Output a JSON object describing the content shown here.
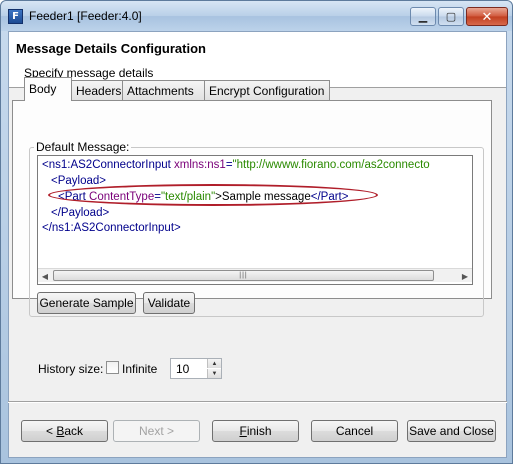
{
  "window": {
    "title": "Feeder1 [Feeder:4.0]",
    "app_icon_letter": "F",
    "controls": {
      "minimize": "▁",
      "maximize": "▢",
      "close": "✕"
    }
  },
  "header": {
    "title": "Message Details Configuration",
    "subtitle": "Specify message details"
  },
  "tabs": [
    {
      "label": "Body",
      "active": true
    },
    {
      "label": "Headers",
      "active": false
    },
    {
      "label": "Attachments",
      "active": false
    },
    {
      "label": "Encrypt Configuration",
      "active": false
    }
  ],
  "body_tab": {
    "group_label": "Default Message:",
    "editor_lines": [
      {
        "open": "<ns1:AS2ConnectorInput ",
        "attr": "xmlns:ns1",
        "eq": "=",
        "value": "\"http://wwww.fiorano.com/as2connecto",
        "text": "",
        "close": ""
      },
      {
        "open": "<Payload>",
        "attr": "",
        "eq": "",
        "value": "",
        "text": "",
        "close": ""
      },
      {
        "open": "<Part ",
        "attr": "ContentType",
        "eq": "=",
        "value": "\"text/plain\"",
        "text": ">Sample message",
        "close": "</Part>"
      },
      {
        "open": "</Payload>",
        "attr": "",
        "eq": "",
        "value": "",
        "text": "",
        "close": ""
      },
      {
        "open": "</ns1:AS2ConnectorInput>",
        "attr": "",
        "eq": "",
        "value": "",
        "text": "",
        "close": ""
      }
    ],
    "scroll_thumb_grip": "|||",
    "buttons": {
      "generate_sample": "Generate Sample",
      "validate": "Validate"
    }
  },
  "history": {
    "label": "History size:",
    "infinite_label": "Infinite",
    "infinite_checked": false,
    "value": "10"
  },
  "footer": {
    "back": {
      "prefix": "< ",
      "mnemonic": "B",
      "rest": "ack"
    },
    "next": "Next >",
    "finish": {
      "mnemonic": "F",
      "rest": "inish"
    },
    "cancel": "Cancel",
    "save_and_close": "Save and Close"
  },
  "colors": {
    "xml_tag": "#00008b",
    "xml_attr": "#7a0079",
    "xml_value": "#2a8a00",
    "highlight_oval": "#b01e2a"
  }
}
